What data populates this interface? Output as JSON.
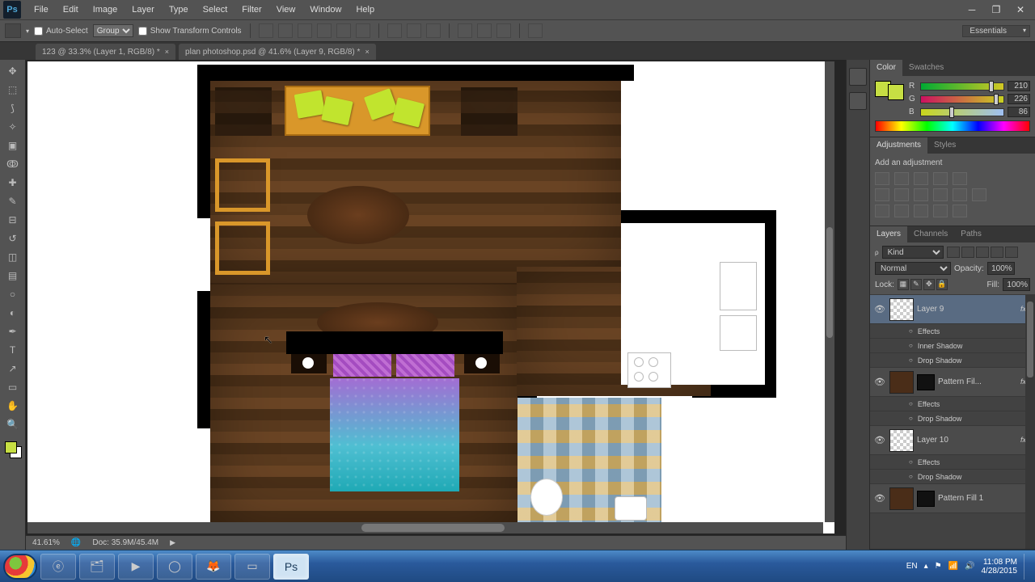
{
  "menu": {
    "items": [
      "File",
      "Edit",
      "Image",
      "Layer",
      "Type",
      "Select",
      "Filter",
      "View",
      "Window",
      "Help"
    ]
  },
  "options": {
    "auto_select": "Auto-Select",
    "group": "Group",
    "show_transform": "Show Transform Controls",
    "essentials": "Essentials"
  },
  "tabs": [
    {
      "label": "123 @ 33.3% (Layer 1, RGB/8) *"
    },
    {
      "label": "plan photoshop.psd @ 41.6% (Layer 9, RGB/8) *"
    }
  ],
  "status": {
    "zoom": "41.61%",
    "doc": "Doc: 35.9M/45.4M"
  },
  "color": {
    "tabs": [
      "Color",
      "Swatches"
    ],
    "r": {
      "label": "R",
      "value": "210",
      "pos": 82
    },
    "g": {
      "label": "G",
      "value": "226",
      "pos": 88
    },
    "b": {
      "label": "B",
      "value": "86",
      "pos": 34
    }
  },
  "adjustments": {
    "tabs": [
      "Adjustments",
      "Styles"
    ],
    "hint": "Add an adjustment"
  },
  "layers": {
    "tabs": [
      "Layers",
      "Channels",
      "Paths"
    ],
    "kind": "Kind",
    "blend": "Normal",
    "opacity_label": "Opacity:",
    "opacity_value": "100%",
    "lock_label": "Lock:",
    "fill_label": "Fill:",
    "fill_value": "100%",
    "items": [
      {
        "name": "Layer 9",
        "selected": true,
        "effects": [
          "Effects",
          "Inner Shadow",
          "Drop Shadow"
        ]
      },
      {
        "name": "Pattern Fil...",
        "brown": true,
        "mask": true,
        "effects": [
          "Effects",
          "Drop Shadow"
        ]
      },
      {
        "name": "Layer 10",
        "effects": [
          "Effects",
          "Drop Shadow"
        ]
      },
      {
        "name": "Pattern Fill 1",
        "brown": true,
        "mask": true
      }
    ]
  },
  "taskbar": {
    "lang": "EN",
    "clock_time": "11:08 PM",
    "clock_date": "4/28/2015"
  }
}
